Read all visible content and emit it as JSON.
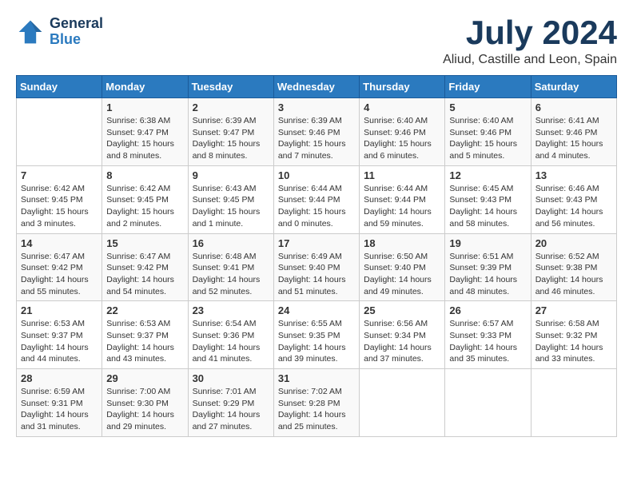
{
  "logo": {
    "line1": "General",
    "line2": "Blue"
  },
  "title": "July 2024",
  "location": "Aliud, Castille and Leon, Spain",
  "weekdays": [
    "Sunday",
    "Monday",
    "Tuesday",
    "Wednesday",
    "Thursday",
    "Friday",
    "Saturday"
  ],
  "weeks": [
    [
      {
        "day": "",
        "sunrise": "",
        "sunset": "",
        "daylight": ""
      },
      {
        "day": "1",
        "sunrise": "Sunrise: 6:38 AM",
        "sunset": "Sunset: 9:47 PM",
        "daylight": "Daylight: 15 hours and 8 minutes."
      },
      {
        "day": "2",
        "sunrise": "Sunrise: 6:39 AM",
        "sunset": "Sunset: 9:47 PM",
        "daylight": "Daylight: 15 hours and 8 minutes."
      },
      {
        "day": "3",
        "sunrise": "Sunrise: 6:39 AM",
        "sunset": "Sunset: 9:46 PM",
        "daylight": "Daylight: 15 hours and 7 minutes."
      },
      {
        "day": "4",
        "sunrise": "Sunrise: 6:40 AM",
        "sunset": "Sunset: 9:46 PM",
        "daylight": "Daylight: 15 hours and 6 minutes."
      },
      {
        "day": "5",
        "sunrise": "Sunrise: 6:40 AM",
        "sunset": "Sunset: 9:46 PM",
        "daylight": "Daylight: 15 hours and 5 minutes."
      },
      {
        "day": "6",
        "sunrise": "Sunrise: 6:41 AM",
        "sunset": "Sunset: 9:46 PM",
        "daylight": "Daylight: 15 hours and 4 minutes."
      }
    ],
    [
      {
        "day": "7",
        "sunrise": "Sunrise: 6:42 AM",
        "sunset": "Sunset: 9:45 PM",
        "daylight": "Daylight: 15 hours and 3 minutes."
      },
      {
        "day": "8",
        "sunrise": "Sunrise: 6:42 AM",
        "sunset": "Sunset: 9:45 PM",
        "daylight": "Daylight: 15 hours and 2 minutes."
      },
      {
        "day": "9",
        "sunrise": "Sunrise: 6:43 AM",
        "sunset": "Sunset: 9:45 PM",
        "daylight": "Daylight: 15 hours and 1 minute."
      },
      {
        "day": "10",
        "sunrise": "Sunrise: 6:44 AM",
        "sunset": "Sunset: 9:44 PM",
        "daylight": "Daylight: 15 hours and 0 minutes."
      },
      {
        "day": "11",
        "sunrise": "Sunrise: 6:44 AM",
        "sunset": "Sunset: 9:44 PM",
        "daylight": "Daylight: 14 hours and 59 minutes."
      },
      {
        "day": "12",
        "sunrise": "Sunrise: 6:45 AM",
        "sunset": "Sunset: 9:43 PM",
        "daylight": "Daylight: 14 hours and 58 minutes."
      },
      {
        "day": "13",
        "sunrise": "Sunrise: 6:46 AM",
        "sunset": "Sunset: 9:43 PM",
        "daylight": "Daylight: 14 hours and 56 minutes."
      }
    ],
    [
      {
        "day": "14",
        "sunrise": "Sunrise: 6:47 AM",
        "sunset": "Sunset: 9:42 PM",
        "daylight": "Daylight: 14 hours and 55 minutes."
      },
      {
        "day": "15",
        "sunrise": "Sunrise: 6:47 AM",
        "sunset": "Sunset: 9:42 PM",
        "daylight": "Daylight: 14 hours and 54 minutes."
      },
      {
        "day": "16",
        "sunrise": "Sunrise: 6:48 AM",
        "sunset": "Sunset: 9:41 PM",
        "daylight": "Daylight: 14 hours and 52 minutes."
      },
      {
        "day": "17",
        "sunrise": "Sunrise: 6:49 AM",
        "sunset": "Sunset: 9:40 PM",
        "daylight": "Daylight: 14 hours and 51 minutes."
      },
      {
        "day": "18",
        "sunrise": "Sunrise: 6:50 AM",
        "sunset": "Sunset: 9:40 PM",
        "daylight": "Daylight: 14 hours and 49 minutes."
      },
      {
        "day": "19",
        "sunrise": "Sunrise: 6:51 AM",
        "sunset": "Sunset: 9:39 PM",
        "daylight": "Daylight: 14 hours and 48 minutes."
      },
      {
        "day": "20",
        "sunrise": "Sunrise: 6:52 AM",
        "sunset": "Sunset: 9:38 PM",
        "daylight": "Daylight: 14 hours and 46 minutes."
      }
    ],
    [
      {
        "day": "21",
        "sunrise": "Sunrise: 6:53 AM",
        "sunset": "Sunset: 9:37 PM",
        "daylight": "Daylight: 14 hours and 44 minutes."
      },
      {
        "day": "22",
        "sunrise": "Sunrise: 6:53 AM",
        "sunset": "Sunset: 9:37 PM",
        "daylight": "Daylight: 14 hours and 43 minutes."
      },
      {
        "day": "23",
        "sunrise": "Sunrise: 6:54 AM",
        "sunset": "Sunset: 9:36 PM",
        "daylight": "Daylight: 14 hours and 41 minutes."
      },
      {
        "day": "24",
        "sunrise": "Sunrise: 6:55 AM",
        "sunset": "Sunset: 9:35 PM",
        "daylight": "Daylight: 14 hours and 39 minutes."
      },
      {
        "day": "25",
        "sunrise": "Sunrise: 6:56 AM",
        "sunset": "Sunset: 9:34 PM",
        "daylight": "Daylight: 14 hours and 37 minutes."
      },
      {
        "day": "26",
        "sunrise": "Sunrise: 6:57 AM",
        "sunset": "Sunset: 9:33 PM",
        "daylight": "Daylight: 14 hours and 35 minutes."
      },
      {
        "day": "27",
        "sunrise": "Sunrise: 6:58 AM",
        "sunset": "Sunset: 9:32 PM",
        "daylight": "Daylight: 14 hours and 33 minutes."
      }
    ],
    [
      {
        "day": "28",
        "sunrise": "Sunrise: 6:59 AM",
        "sunset": "Sunset: 9:31 PM",
        "daylight": "Daylight: 14 hours and 31 minutes."
      },
      {
        "day": "29",
        "sunrise": "Sunrise: 7:00 AM",
        "sunset": "Sunset: 9:30 PM",
        "daylight": "Daylight: 14 hours and 29 minutes."
      },
      {
        "day": "30",
        "sunrise": "Sunrise: 7:01 AM",
        "sunset": "Sunset: 9:29 PM",
        "daylight": "Daylight: 14 hours and 27 minutes."
      },
      {
        "day": "31",
        "sunrise": "Sunrise: 7:02 AM",
        "sunset": "Sunset: 9:28 PM",
        "daylight": "Daylight: 14 hours and 25 minutes."
      },
      {
        "day": "",
        "sunrise": "",
        "sunset": "",
        "daylight": ""
      },
      {
        "day": "",
        "sunrise": "",
        "sunset": "",
        "daylight": ""
      },
      {
        "day": "",
        "sunrise": "",
        "sunset": "",
        "daylight": ""
      }
    ]
  ]
}
